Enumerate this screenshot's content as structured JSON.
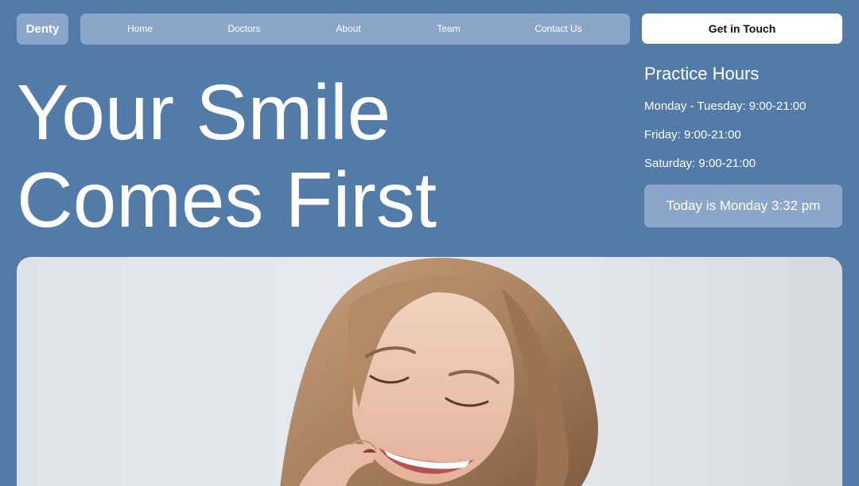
{
  "brand": {
    "logo": "Denty"
  },
  "nav": {
    "items": [
      {
        "label": "Home"
      },
      {
        "label": "Doctors"
      },
      {
        "label": "About"
      },
      {
        "label": "Team"
      },
      {
        "label": "Contact Us"
      }
    ]
  },
  "header": {
    "cta_label": "Get in Touch"
  },
  "hero": {
    "title_line1": "Your Smile",
    "title_line2": "Comes First"
  },
  "hours": {
    "title": "Practice Hours",
    "lines": [
      "Monday - Tuesday: 9:00-21:00",
      "Friday: 9:00-21:00",
      "Saturday: 9:00-21:00"
    ],
    "today": "Today is Monday 3:32 pm"
  },
  "colors": {
    "background": "#537ba8",
    "panel": "#8aa6c8",
    "cta_bg": "#ffffff",
    "cta_text": "#111111"
  }
}
